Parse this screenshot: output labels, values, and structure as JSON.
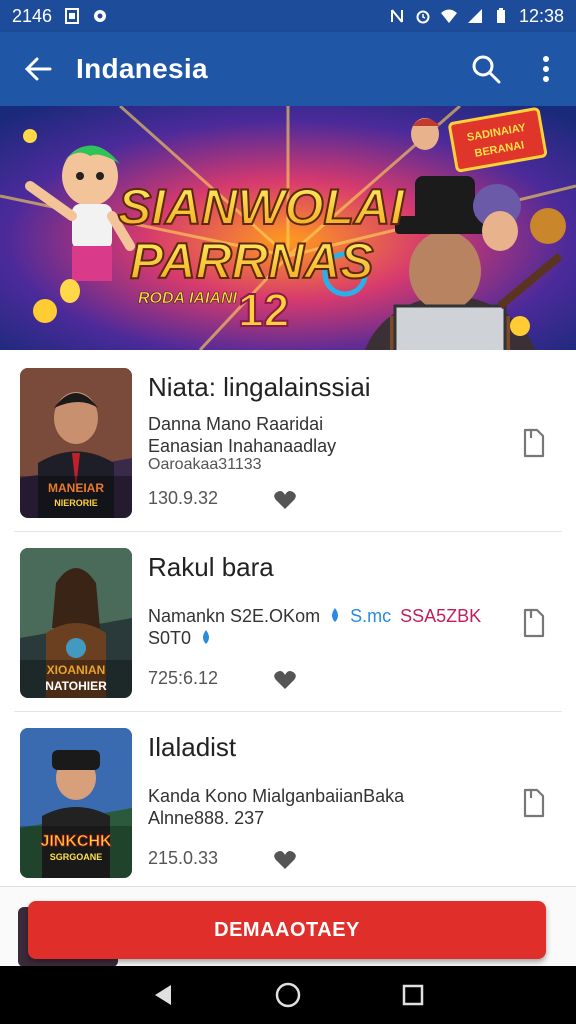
{
  "status": {
    "time_left": "2146",
    "time_right": "12:38",
    "icons": [
      "sim-icon",
      "settings-icon",
      "nfc-icon",
      "alarm-icon",
      "wifi-icon",
      "signal-icon",
      "battery-icon"
    ]
  },
  "app_bar": {
    "title": "Indanesia",
    "icons": [
      "back-arrow-icon",
      "search-icon",
      "more-vert-icon"
    ]
  },
  "banner": {
    "headline_line1": "SIANWOLAI",
    "headline_line2": "PARRNAS",
    "tagline": "RODA IAIANI",
    "number": "12",
    "badge_line1": "SADINAIAY",
    "badge_line2": "BERANAI"
  },
  "items": [
    {
      "title": "Niata: lingalainssiai",
      "line1": "Danna Mano Raaridai",
      "line2": "Eanasian Inahanaadlay",
      "line3": "Oaroakaa31133",
      "price": "130.9.32",
      "thumb_caption": "MANEIAR",
      "thumb_subcaption": "NIERORIE"
    },
    {
      "title": "Rakul bara",
      "line1": "Namankn S2E.OKom",
      "line1_mid": "S.mc",
      "line1_tail": "SSA5ZBK",
      "line2": "S0T0",
      "price": "725:6.12",
      "thumb_caption": "XIOANIAN",
      "thumb_subcaption": "NATOHIER"
    },
    {
      "title": "Ilaladist",
      "line1": "Kanda Kono MialganbaiianBaka",
      "line2": "Alnne888. 237",
      "price": "215.0.33",
      "thumb_caption": "JINKCHK",
      "thumb_subcaption": "SGRGOANE"
    }
  ],
  "cta": {
    "label": "DEMAAOTAEY"
  },
  "nav": {
    "icons": [
      "back-triangle-icon",
      "home-circle-icon",
      "recents-square-icon"
    ]
  },
  "colors": {
    "app_bar": "#1f56a6",
    "status_bar": "#1d4d9a",
    "cta": "#e02f2a",
    "nav": "#000000"
  }
}
